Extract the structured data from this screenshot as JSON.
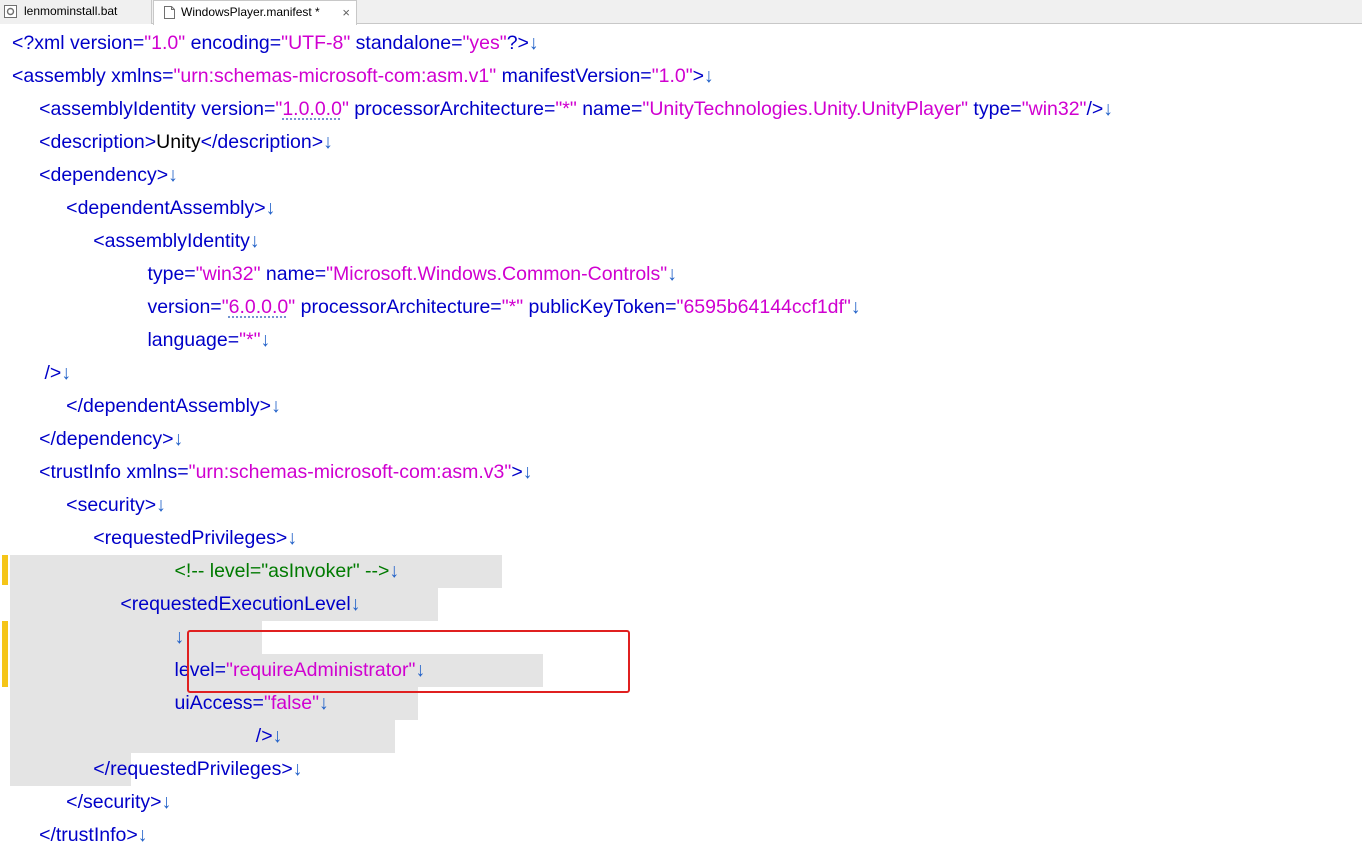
{
  "tabs": [
    {
      "label": "lenmominstall.bat",
      "active": false
    },
    {
      "label": "WindowsPlayer.manifest *",
      "active": true,
      "close": "×"
    }
  ],
  "colors": {
    "tag": "#0000c8",
    "value": "#d000d0",
    "comment": "#007a00",
    "eol": "#2060c8",
    "selection": "#e4e4e4",
    "change_marker": "#f5c518",
    "highlight_box": "#e02020"
  },
  "icons": {
    "tab_file": "document-icon",
    "tab_close": "close-icon"
  },
  "editor": {
    "eol": "↓",
    "lines": [
      [
        [
          "t",
          "<?xml version="
        ],
        [
          "v",
          "\"1.0\""
        ],
        [
          "t",
          " encoding="
        ],
        [
          "v",
          "\"UTF-8\""
        ],
        [
          "t",
          " standalone="
        ],
        [
          "v",
          "\"yes\""
        ],
        [
          "t",
          "?>"
        ]
      ],
      [
        [
          "t",
          "<assembly xmlns="
        ],
        [
          "v",
          "\"urn:schemas-microsoft-com:asm.v1\""
        ],
        [
          "t",
          " manifestVersion="
        ],
        [
          "v",
          "\"1.0\""
        ],
        [
          "t",
          ">"
        ]
      ],
      [
        [
          "t",
          "     <assemblyIdentity version="
        ],
        [
          "v",
          "\""
        ],
        [
          "vu",
          "1.0.0.0"
        ],
        [
          "v",
          "\""
        ],
        [
          "t",
          " processorArchitecture="
        ],
        [
          "v",
          "\"*\""
        ],
        [
          "t",
          " name="
        ],
        [
          "v",
          "\"UnityTechnologies.Unity.UnityPlayer\""
        ],
        [
          "t",
          " type="
        ],
        [
          "v",
          "\"win32\""
        ],
        [
          "t",
          "/>"
        ]
      ],
      [
        [
          "t",
          "     <description>"
        ],
        [
          "p",
          "Unity"
        ],
        [
          "t",
          "</description>"
        ]
      ],
      [
        [
          "t",
          "     <dependency>"
        ]
      ],
      [
        [
          "t",
          "          <dependentAssembly>"
        ]
      ],
      [
        [
          "t",
          "               <assemblyIdentity"
        ]
      ],
      [
        [
          "t",
          "                         type="
        ],
        [
          "v",
          "\"win32\""
        ],
        [
          "t",
          " name="
        ],
        [
          "v",
          "\"Microsoft.Windows.Common-Controls\""
        ]
      ],
      [
        [
          "t",
          "                         version="
        ],
        [
          "v",
          "\""
        ],
        [
          "vu",
          "6.0.0.0"
        ],
        [
          "v",
          "\""
        ],
        [
          "t",
          " processorArchitecture="
        ],
        [
          "v",
          "\"*\""
        ],
        [
          "t",
          " publicKeyToken="
        ],
        [
          "v",
          "\"6595b64144ccf1df\""
        ]
      ],
      [
        [
          "t",
          "                         language="
        ],
        [
          "v",
          "\"*\""
        ]
      ],
      [
        [
          "t",
          "      />"
        ]
      ],
      [
        [
          "t",
          "          </dependentAssembly>"
        ]
      ],
      [
        [
          "t",
          "     </dependency>"
        ]
      ],
      [
        [
          "t",
          "     <trustInfo xmlns="
        ],
        [
          "v",
          "\"urn:schemas-microsoft-com:asm.v3\""
        ],
        [
          "t",
          ">"
        ]
      ],
      [
        [
          "t",
          "          <security>"
        ]
      ],
      [
        [
          "t",
          "               <requestedPrivileges>"
        ]
      ],
      [
        [
          "c",
          "                              <!-- level=\"asInvoker\" -->"
        ]
      ],
      [
        [
          "t",
          "                    <requestedExecutionLevel"
        ]
      ],
      [
        [
          "t",
          "                              "
        ]
      ],
      [
        [
          "t",
          "                              level="
        ],
        [
          "v",
          "\"requireAdministrator\""
        ]
      ],
      [
        [
          "t",
          "                              uiAccess="
        ],
        [
          "v",
          "\"false\""
        ]
      ],
      [
        [
          "t",
          "                                             />"
        ]
      ],
      [
        [
          "t",
          "               </requestedPrivileges>"
        ]
      ],
      [
        [
          "t",
          "          </security>"
        ]
      ],
      [
        [
          "t",
          "     </trustInfo>"
        ]
      ]
    ]
  }
}
